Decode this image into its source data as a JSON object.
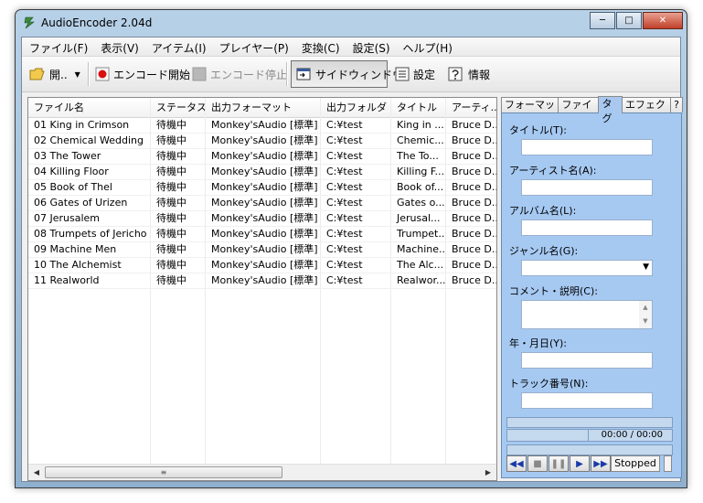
{
  "window": {
    "title": "AudioEncoder 2.04d"
  },
  "menu": [
    "ファイル(F)",
    "表示(V)",
    "アイテム(I)",
    "プレイヤー(P)",
    "変換(C)",
    "設定(S)",
    "ヘルプ(H)"
  ],
  "toolbar": {
    "open_label": "開..",
    "encode_start_label": "エンコード開始",
    "encode_stop_label": "エンコード停止",
    "side_window_label": "サイドウィンドウ",
    "settings_label": "設定",
    "info_label": "情報"
  },
  "list": {
    "columns": [
      "ファイル名",
      "ステータス",
      "出力フォーマット",
      "出力フォルダ",
      "タイトル",
      "アーティ..."
    ],
    "rows": [
      [
        "01 King in Crimson",
        "待機中",
        "Monkey'sAudio [標準]",
        "C:¥test",
        "King in ...",
        "Bruce D..."
      ],
      [
        "02 Chemical Wedding",
        "待機中",
        "Monkey'sAudio [標準]",
        "C:¥test",
        "Chemic...",
        "Bruce D..."
      ],
      [
        "03 The Tower",
        "待機中",
        "Monkey'sAudio [標準]",
        "C:¥test",
        "The To...",
        "Bruce D..."
      ],
      [
        "04 Killing Floor",
        "待機中",
        "Monkey'sAudio [標準]",
        "C:¥test",
        "Killing F...",
        "Bruce D..."
      ],
      [
        "05 Book of Thel",
        "待機中",
        "Monkey'sAudio [標準]",
        "C:¥test",
        "Book of...",
        "Bruce D..."
      ],
      [
        "06 Gates of Urizen",
        "待機中",
        "Monkey'sAudio [標準]",
        "C:¥test",
        "Gates o...",
        "Bruce D..."
      ],
      [
        "07 Jerusalem",
        "待機中",
        "Monkey'sAudio [標準]",
        "C:¥test",
        "Jerusal...",
        "Bruce D..."
      ],
      [
        "08 Trumpets of Jericho",
        "待機中",
        "Monkey'sAudio [標準]",
        "C:¥test",
        "Trumpet...",
        "Bruce D..."
      ],
      [
        "09 Machine Men",
        "待機中",
        "Monkey'sAudio [標準]",
        "C:¥test",
        "Machine...",
        "Bruce D..."
      ],
      [
        "10 The Alchemist",
        "待機中",
        "Monkey'sAudio [標準]",
        "C:¥test",
        "The Alc...",
        "Bruce D..."
      ],
      [
        "11 Realworld",
        "待機中",
        "Monkey'sAudio [標準]",
        "C:¥test",
        "Realwor...",
        "Bruce D..."
      ]
    ]
  },
  "sidebar": {
    "tabs": [
      "フォーマット",
      "ファイル",
      "タグ",
      "エフェクト",
      "?"
    ],
    "active_tab": "タグ",
    "fields": {
      "title_label": "タイトル(T):",
      "artist_label": "アーティスト名(A):",
      "album_label": "アルバム名(L):",
      "genre_label": "ジャンル名(G):",
      "comment_label": "コメント・説明(C):",
      "year_label": "年・月日(Y):",
      "track_label": "トラック番号(N):"
    },
    "time_display": "00:00 / 00:00",
    "player_status": "Stopped"
  },
  "colors": {
    "tag_panel": "#a6c9f2",
    "record_red": "#d81010",
    "player_blue": "#1a3aa8"
  }
}
